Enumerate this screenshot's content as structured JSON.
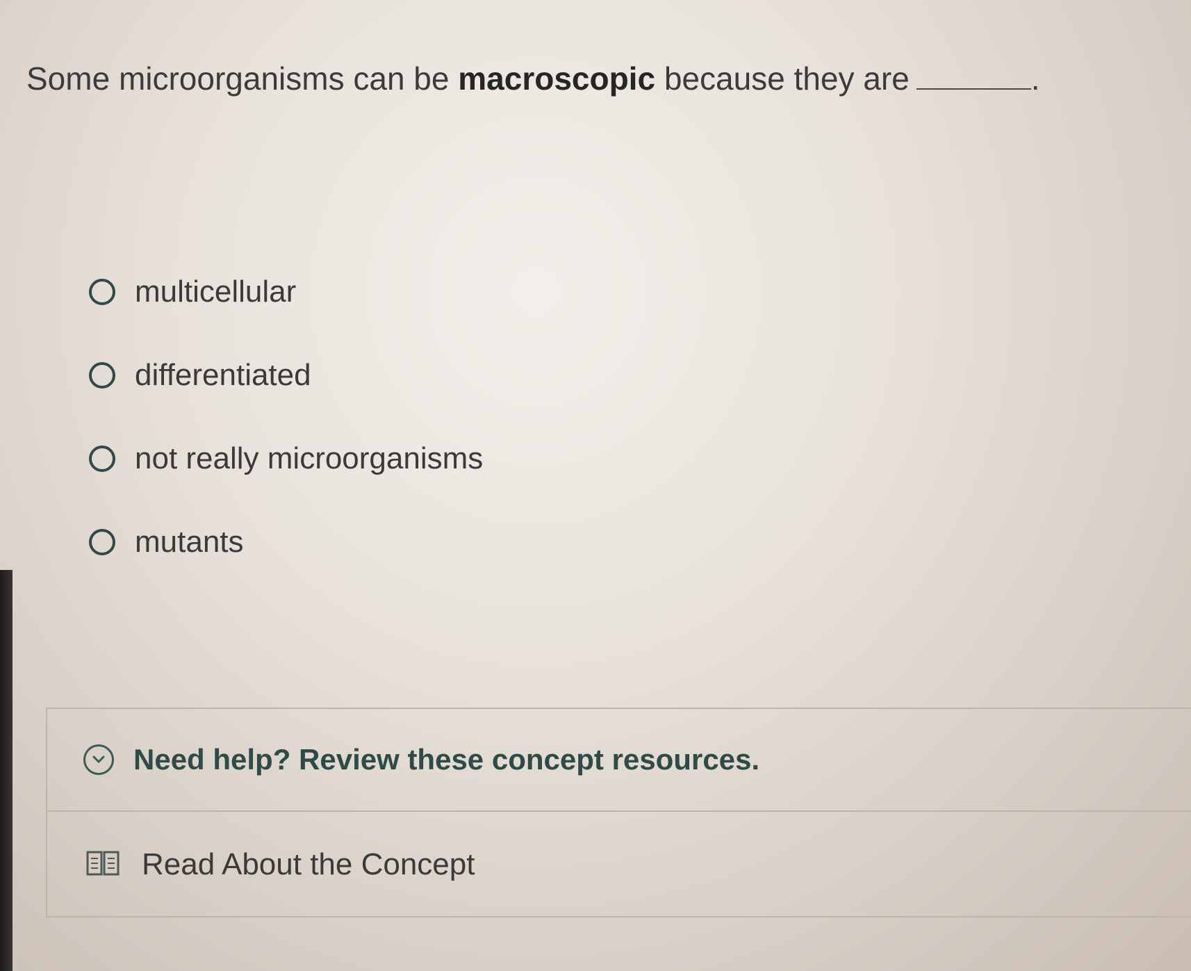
{
  "question": {
    "prefix": "Some microorganisms can be",
    "bold": "macroscopic",
    "suffix": "because they are",
    "end": "."
  },
  "options": [
    {
      "label": "multicellular"
    },
    {
      "label": "differentiated"
    },
    {
      "label": "not really microorganisms"
    },
    {
      "label": "mutants"
    }
  ],
  "help": {
    "title": "Need help? Review these concept resources.",
    "resources": [
      {
        "label": "Read About the Concept",
        "icon": "book-icon"
      }
    ]
  },
  "colors": {
    "accent": "#2f4b48",
    "text": "#3a3a3a"
  }
}
